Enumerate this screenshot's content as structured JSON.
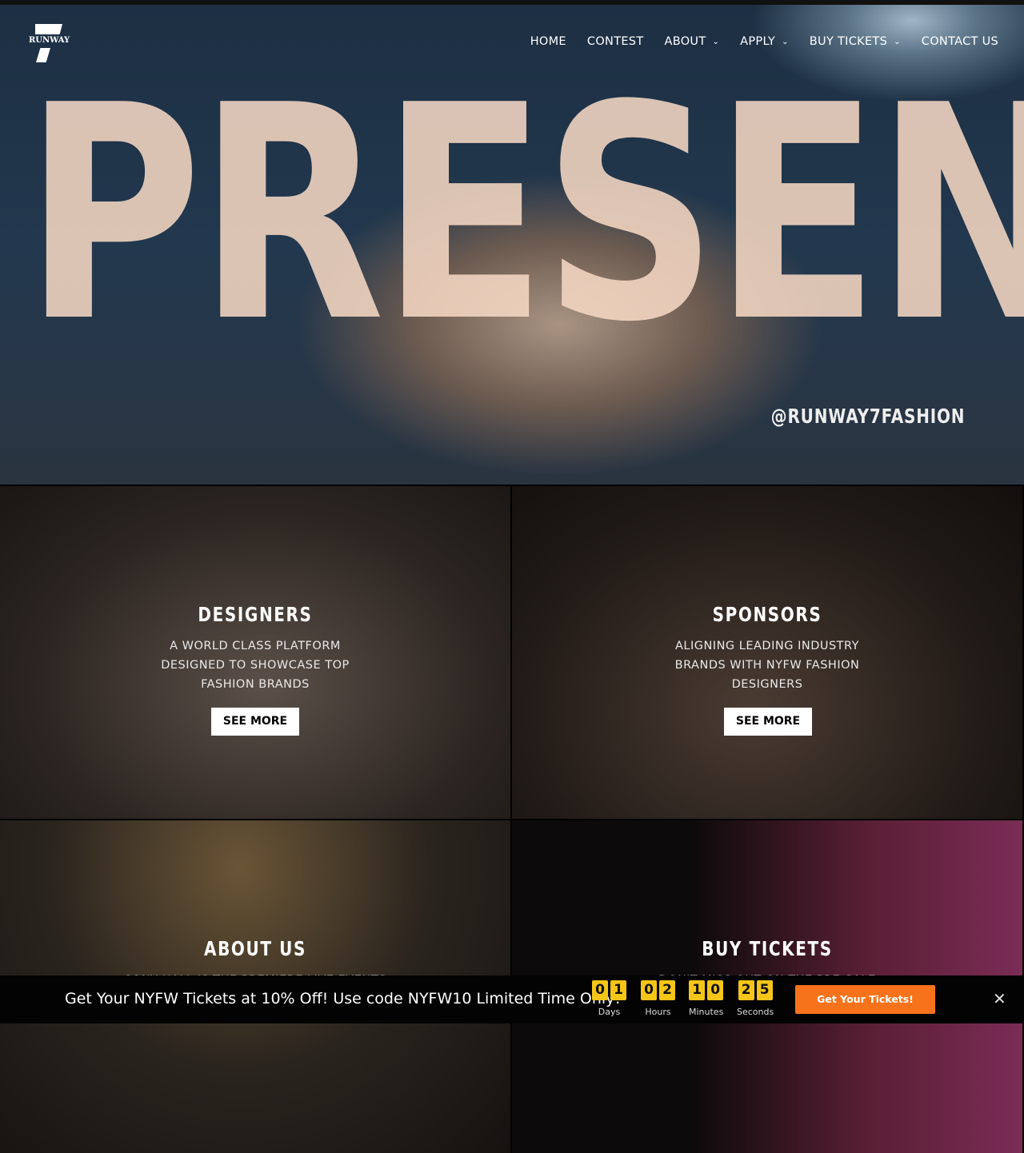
{
  "nav": {
    "logo_text": "RUNWAY",
    "items": [
      {
        "label": "HOME",
        "dropdown": false
      },
      {
        "label": "CONTEST",
        "dropdown": false
      },
      {
        "label": "ABOUT",
        "dropdown": true
      },
      {
        "label": "APPLY",
        "dropdown": true
      },
      {
        "label": "BUY TICKETS",
        "dropdown": true
      },
      {
        "label": "CONTACT US",
        "dropdown": false
      }
    ]
  },
  "hero": {
    "word": "PRESENTS",
    "handle": "@RUNWAY7FASHION"
  },
  "tiles": [
    {
      "title": "DESIGNERS",
      "text": "A WORLD CLASS PLATFORM DESIGNED TO SHOWCASE TOP FASHION BRANDS",
      "button": "SEE MORE"
    },
    {
      "title": "SPONSORS",
      "text": "ALIGNING LEADING INDUSTRY BRANDS WITH NYFW FASHION DESIGNERS",
      "button": "SEE MORE"
    },
    {
      "title": "ABOUT US",
      "text": "SONY HALL IS THE PREMIERE LIVE EVENTS"
    },
    {
      "title": "BUY TICKETS",
      "text": "DON'T MISS OUT ON THE PRE-SALE"
    }
  ],
  "promo": {
    "text": "Get Your NYFW Tickets at 10% Off! Use code NYFW10 Limited Time Only!",
    "countdown": [
      {
        "digits": [
          "0",
          "1"
        ],
        "label": "Days"
      },
      {
        "digits": [
          "0",
          "2"
        ],
        "label": "Hours"
      },
      {
        "digits": [
          "1",
          "0"
        ],
        "label": "Minutes"
      },
      {
        "digits": [
          "2",
          "5"
        ],
        "label": "Seconds"
      }
    ],
    "cta": "Get Your Tickets!",
    "close": "✕",
    "accent": "#f7731b",
    "digit_color": "#f5c518"
  }
}
